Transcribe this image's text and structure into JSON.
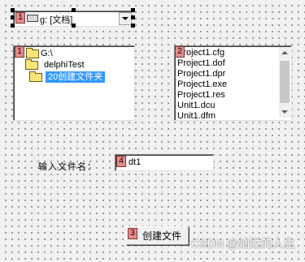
{
  "drive_combo": {
    "value": "g: [文档]",
    "badge": "1"
  },
  "directory_list": {
    "badge": "1",
    "items": [
      {
        "label": "G:\\"
      },
      {
        "label": "delphiTest"
      },
      {
        "label": "20创建文件夹",
        "selected": true
      }
    ]
  },
  "file_list": {
    "badge": "2",
    "items": [
      "Project1.cfg",
      "Project1.dof",
      "Project1.dpr",
      "Project1.exe",
      "Project1.res",
      "Unit1.dcu",
      "Unit1.dfm"
    ]
  },
  "name_field": {
    "label": "输入文件名：",
    "value": "dt1",
    "badge": "4"
  },
  "create_button": {
    "label": "创建文件",
    "badge": "3"
  },
  "watermark": "CSDN @灿烂的人生",
  "colors": {
    "selection": "#3399ff",
    "badge": "#e88a8a",
    "folder": "#ffe47a"
  }
}
